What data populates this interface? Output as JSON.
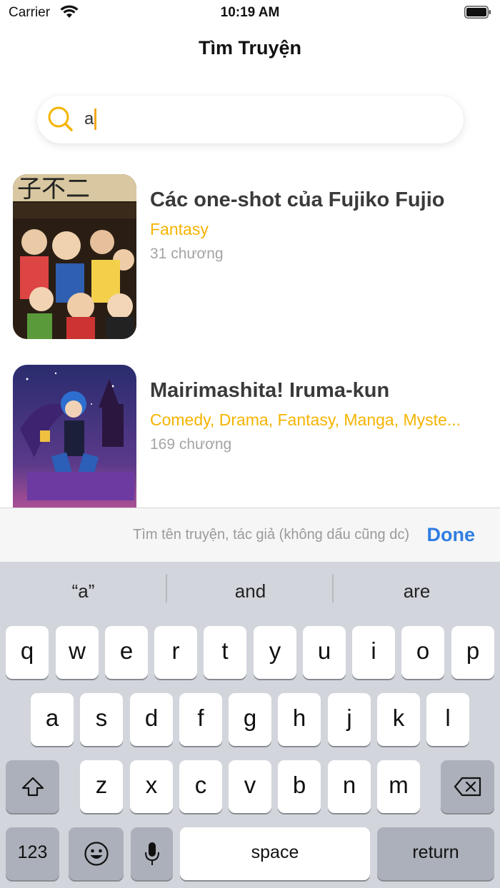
{
  "status_bar": {
    "carrier": "Carrier",
    "time": "10:19 AM"
  },
  "nav": {
    "title": "Tìm Truyện"
  },
  "search": {
    "query": "a"
  },
  "results": [
    {
      "title": "Các one-shot của Fujiko Fujio",
      "genres": "Fantasy",
      "chapters": "31 chương"
    },
    {
      "title": "Mairimashita! Iruma-kun",
      "genres": "Comedy, Drama, Fantasy, Manga, Myste...",
      "chapters": "169 chương"
    }
  ],
  "accessory": {
    "hint": "Tìm tên truyện, tác giả (không dấu cũng dc)",
    "done_label": "Done"
  },
  "keyboard": {
    "suggestions": [
      "“a”",
      "and",
      "are"
    ],
    "row1": [
      "q",
      "w",
      "e",
      "r",
      "t",
      "y",
      "u",
      "i",
      "o",
      "p"
    ],
    "row2": [
      "a",
      "s",
      "d",
      "f",
      "g",
      "h",
      "j",
      "k",
      "l"
    ],
    "row3": [
      "z",
      "x",
      "c",
      "v",
      "b",
      "n",
      "m"
    ],
    "numbers_label": "123",
    "space_label": "space",
    "return_label": "return"
  },
  "colors": {
    "accent": "#f5b400",
    "done_blue": "#2f7de1"
  }
}
